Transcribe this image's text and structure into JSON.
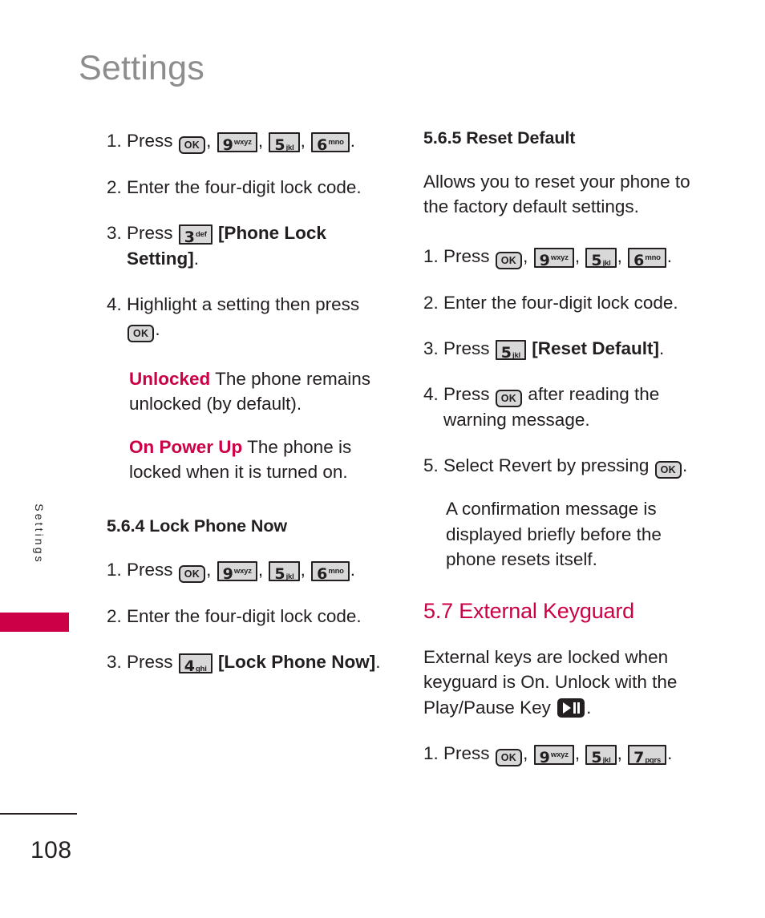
{
  "page": {
    "title": "Settings",
    "side_tab_label": "Settings",
    "page_number": "108",
    "accent_color": "#cc0047",
    "title_color": "#8d8d8d",
    "text_color": "#231f20"
  },
  "keys": {
    "ok": {
      "digit": "OK",
      "letters": ""
    },
    "three": {
      "digit": "3",
      "letters": "def"
    },
    "four": {
      "digit": "4",
      "letters": "ghi"
    },
    "five": {
      "digit": "5",
      "letters": "jkl"
    },
    "six": {
      "digit": "6",
      "letters": "mno"
    },
    "seven": {
      "digit": "7",
      "letters": "pqrs"
    },
    "nine": {
      "digit": "9",
      "letters": "wxyz"
    },
    "play_pause": "play-pause"
  },
  "left_column": {
    "step1": {
      "num": "1.",
      "text_before": "Press",
      "comma1": ",",
      "comma2": ",",
      "comma3": ",",
      "period": "."
    },
    "step2": {
      "num": "2.",
      "text": "Enter the four-digit lock code."
    },
    "step3": {
      "num": "3.",
      "text_before": "Press",
      "bracket": "[Phone Lock Setting]",
      "period": "."
    },
    "step4": {
      "num": "4.",
      "text_before": "Highlight a setting then press",
      "period": "."
    },
    "def_unlocked": {
      "term": "Unlocked",
      "desc": "The phone remains unlocked (by default)."
    },
    "def_onpowerup": {
      "term": "On Power Up",
      "desc": "The phone is locked when it is turned on."
    },
    "heading_564": "5.6.4 Lock Phone Now",
    "s564_step1": {
      "num": "1.",
      "text_before": "Press",
      "comma1": ",",
      "comma2": ",",
      "comma3": ",",
      "period": "."
    },
    "s564_step2": {
      "num": "2.",
      "text": "Enter the four-digit lock code."
    },
    "s564_step3": {
      "num": "3.",
      "text_before": "Press",
      "bracket": "[Lock Phone Now]",
      "period": "."
    }
  },
  "right_column": {
    "heading_565": "5.6.5 Reset Default",
    "intro_565": "Allows you to reset your phone to the factory default settings.",
    "step1": {
      "num": "1.",
      "text_before": "Press",
      "comma1": ",",
      "comma2": ",",
      "comma3": ",",
      "period": "."
    },
    "step2": {
      "num": "2.",
      "text": "Enter the four-digit lock code."
    },
    "step3": {
      "num": "3.",
      "text_before": "Press",
      "bracket": "[Reset Default]",
      "period": "."
    },
    "step4": {
      "num": "4.",
      "text_before": "Press",
      "text_after": "after reading the warning message."
    },
    "step5": {
      "num": "5.",
      "text_before": "Select Revert by pressing",
      "period": "."
    },
    "note_565": "A confirmation message is displayed briefly before the phone resets itself.",
    "heading_57": "5.7 External Keyguard",
    "intro_57_a": "External keys are locked when keyguard is On. Unlock with the Play/Pause Key",
    "intro_57_b": ".",
    "s57_step1": {
      "num": "1.",
      "text_before": "Press",
      "comma1": ",",
      "comma2": ",",
      "comma3": ",",
      "period": "."
    }
  }
}
